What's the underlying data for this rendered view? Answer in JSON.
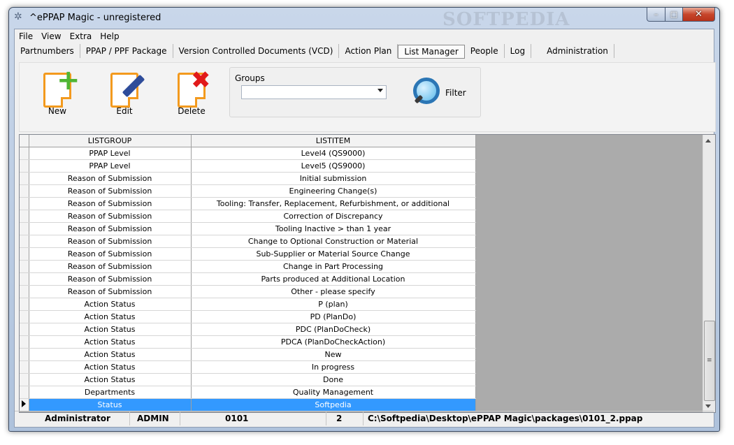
{
  "window": {
    "title": "^ePPAP Magic - unregistered",
    "watermark": "SOFTPEDIA",
    "minimize": "–",
    "maximize": "□",
    "close": "✕"
  },
  "menu": [
    "File",
    "View",
    "Extra",
    "Help"
  ],
  "tabs": [
    "Partnumbers",
    "PPAP / PPF Package",
    "Version Controlled Documents (VCD)",
    "Action Plan",
    "List Manager",
    "People",
    "Log",
    "Administration"
  ],
  "active_tab": "List Manager",
  "toolbar": {
    "new_label": "New",
    "edit_label": "Edit",
    "delete_label": "Delete",
    "groups_label": "Groups",
    "groups_value": "",
    "filter_label": "Filter"
  },
  "grid": {
    "columns": [
      "LISTGROUP",
      "LISTITEM"
    ],
    "rows": [
      [
        "PPAP Level",
        "Level4 (QS9000)"
      ],
      [
        "PPAP Level",
        "Level5 (QS9000)"
      ],
      [
        "Reason of Submission",
        "Initial submission"
      ],
      [
        "Reason of Submission",
        "Engineering Change(s)"
      ],
      [
        "Reason of Submission",
        "Tooling: Transfer, Replacement, Refurbishment, or additional"
      ],
      [
        "Reason of Submission",
        "Correction of Discrepancy"
      ],
      [
        "Reason of Submission",
        "Tooling Inactive > than 1 year"
      ],
      [
        "Reason of Submission",
        "Change to Optional Construction or Material"
      ],
      [
        "Reason of Submission",
        "Sub-Supplier or Material Source Change"
      ],
      [
        "Reason of Submission",
        "Change in Part Processing"
      ],
      [
        "Reason of Submission",
        "Parts produced at Additional Location"
      ],
      [
        "Reason of Submission",
        "Other - please specify"
      ],
      [
        "Action Status",
        "P (plan)"
      ],
      [
        "Action Status",
        "PD (PlanDo)"
      ],
      [
        "Action Status",
        "PDC (PlanDoCheck)"
      ],
      [
        "Action Status",
        "PDCA (PlanDoCheckAction)"
      ],
      [
        "Action Status",
        "New"
      ],
      [
        "Action Status",
        "In progress"
      ],
      [
        "Action Status",
        "Done"
      ],
      [
        "Departments",
        "Quality Management"
      ],
      [
        "Status",
        "Softpedia"
      ]
    ],
    "selected_row": 20
  },
  "status": {
    "user": "Administrator",
    "role": "ADMIN",
    "code": "0101",
    "number": "2",
    "path": "C:\\Softpedia\\Desktop\\ePPAP Magic\\packages\\0101_2.ppap"
  },
  "colors": {
    "selection": "#3399ff",
    "new_icon": "#4fb534",
    "delete_icon": "#e11a1a",
    "doc_icon": "#f39a1e"
  }
}
